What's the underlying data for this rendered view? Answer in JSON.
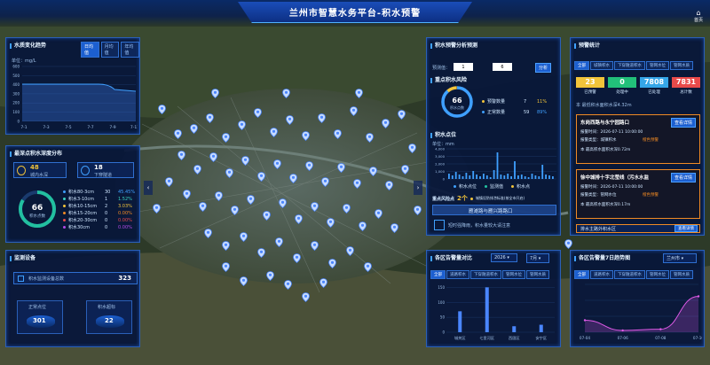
{
  "header": {
    "title": "兰州市智慧水务平台-积水预警",
    "home_label": "首页"
  },
  "water_trend": {
    "title": "水质变化趋势",
    "tabs": [
      "日均值",
      "月均值",
      "年均值"
    ],
    "unit_label": "单位：mg/L",
    "y_ticks": [
      "600",
      "500",
      "400",
      "300",
      "200",
      "100",
      "0"
    ],
    "x_ticks": [
      "7-1",
      "7-3",
      "7-5",
      "7-7",
      "7-9",
      "7-11"
    ]
  },
  "depth_dist": {
    "title": "最深点积水深度分布",
    "stat1": {
      "value": "48",
      "label": "城内水深"
    },
    "stat2": {
      "value": "18",
      "label": "下穿隧道"
    },
    "ring_value": "66",
    "ring_label": "积水点数",
    "legend": [
      {
        "label": "积水80-3cm",
        "count": "30",
        "pct": "45.45%",
        "color": "#3fa0ff"
      },
      {
        "label": "积水3-10cm",
        "count": "1",
        "pct": "1.52%",
        "color": "#3ad3c0"
      },
      {
        "label": "积水10-15cm",
        "count": "2",
        "pct": "3.03%",
        "color": "#f2c43a"
      },
      {
        "label": "积水15-20cm",
        "count": "0",
        "pct": "0.00%",
        "color": "#f08a24"
      },
      {
        "label": "积水20-30cm",
        "count": "0",
        "pct": "0.00%",
        "color": "#e84a4a"
      },
      {
        "label": "积水30cm",
        "count": "0",
        "pct": "0.00%",
        "color": "#b44ae8"
      }
    ]
  },
  "monitor": {
    "title": "监测设备",
    "device_label": "积水监测设备总数",
    "device_total": "323",
    "normal_label": "正常点位",
    "normal_value": "301",
    "alarm_label": "积水超标",
    "alarm_value": "22"
  },
  "forecast": {
    "title": "积水预警分析预测",
    "forecast_label": "预测值：",
    "input1": "1",
    "input2": "6",
    "confirm": "分析",
    "risk_title": "重点积水风险",
    "ring_value": "66",
    "ring_label": "积水点数",
    "items": [
      {
        "label": "预警数量",
        "count": "7",
        "pct": "11%"
      },
      {
        "label": "正常数量",
        "count": "59",
        "pct": "89%"
      }
    ],
    "water_title": "积水点位",
    "water_unit": "单位：mm",
    "water_y": [
      "4,000",
      "3,000",
      "2,000",
      "1,000",
      "0"
    ],
    "water_legend": [
      "积水点位",
      "监测值",
      "积水点"
    ],
    "risk_row_label": "重点风险点",
    "risk_row_count": "2个",
    "risk_row_note": "城镇设防排涝标准(按全市开启)",
    "road_label": "雁滩路与雁兴路路口",
    "road_note": "短时强降雨，积水量较大请注意"
  },
  "warning_stats": {
    "title": "预警统计",
    "tabs": [
      "全部",
      "城镇积水",
      "下穿隧道积水",
      "管网水位",
      "管网水质"
    ],
    "stats": [
      {
        "value": "23",
        "label": "已预警",
        "color": "#f2c43a"
      },
      {
        "value": "0",
        "label": "处理中",
        "color": "#22c07a"
      },
      {
        "value": "7808",
        "label": "已处理",
        "color": "#35a6e8"
      },
      {
        "value": "7831",
        "label": "总计数",
        "color": "#e84a4a"
      }
    ],
    "note1": "本 最低积水面积水深4.32m",
    "alerts": [
      {
        "title": "东岗西路与永宁园路口",
        "btn": "查看详情",
        "l1": "报警时间：2026-07-11 10:00:00",
        "l2": "报警类型：城镇积水",
        "tag": "橙色预警",
        "l3": "本 最高积水面积水深0.72m"
      },
      {
        "title": "徐中城排十字北莹线（污水水监",
        "btn": "查看详情",
        "l1": "报警时间：2026-07-11 10:00:00",
        "l2": "报警类型：管网水位",
        "tag": "橙色预警",
        "l3": "本 最高积水面积水深0.17m"
      }
    ],
    "footer_label": "排水主路外积水区",
    "footer_btn": "查看详情"
  },
  "region_compare": {
    "title": "各区告警量对比",
    "year": "2026",
    "month": "7月",
    "tabs": [
      "全部",
      "道路积水",
      "下穿隧道积水",
      "管网水位",
      "管网水质"
    ],
    "chart_data": {
      "type": "bar",
      "categories": [
        "城关区",
        "七里河区",
        "西固区",
        "安宁区"
      ],
      "values": [
        70,
        150,
        20,
        25
      ],
      "ylim": [
        0,
        160
      ],
      "y_ticks": [
        "150",
        "100",
        "50",
        "0"
      ]
    }
  },
  "trend7": {
    "title": "各区告警量7日趋势图",
    "district": "兰州市",
    "tabs": [
      "全部",
      "道路积水",
      "下穿隧道积水",
      "管网水位",
      "管网水质"
    ],
    "chart_data": {
      "type": "line",
      "categories": [
        "07-04",
        "07-06",
        "07-08",
        "07-10"
      ],
      "values": [
        20,
        3,
        5,
        60
      ],
      "ylim": [
        0,
        80
      ]
    }
  }
}
